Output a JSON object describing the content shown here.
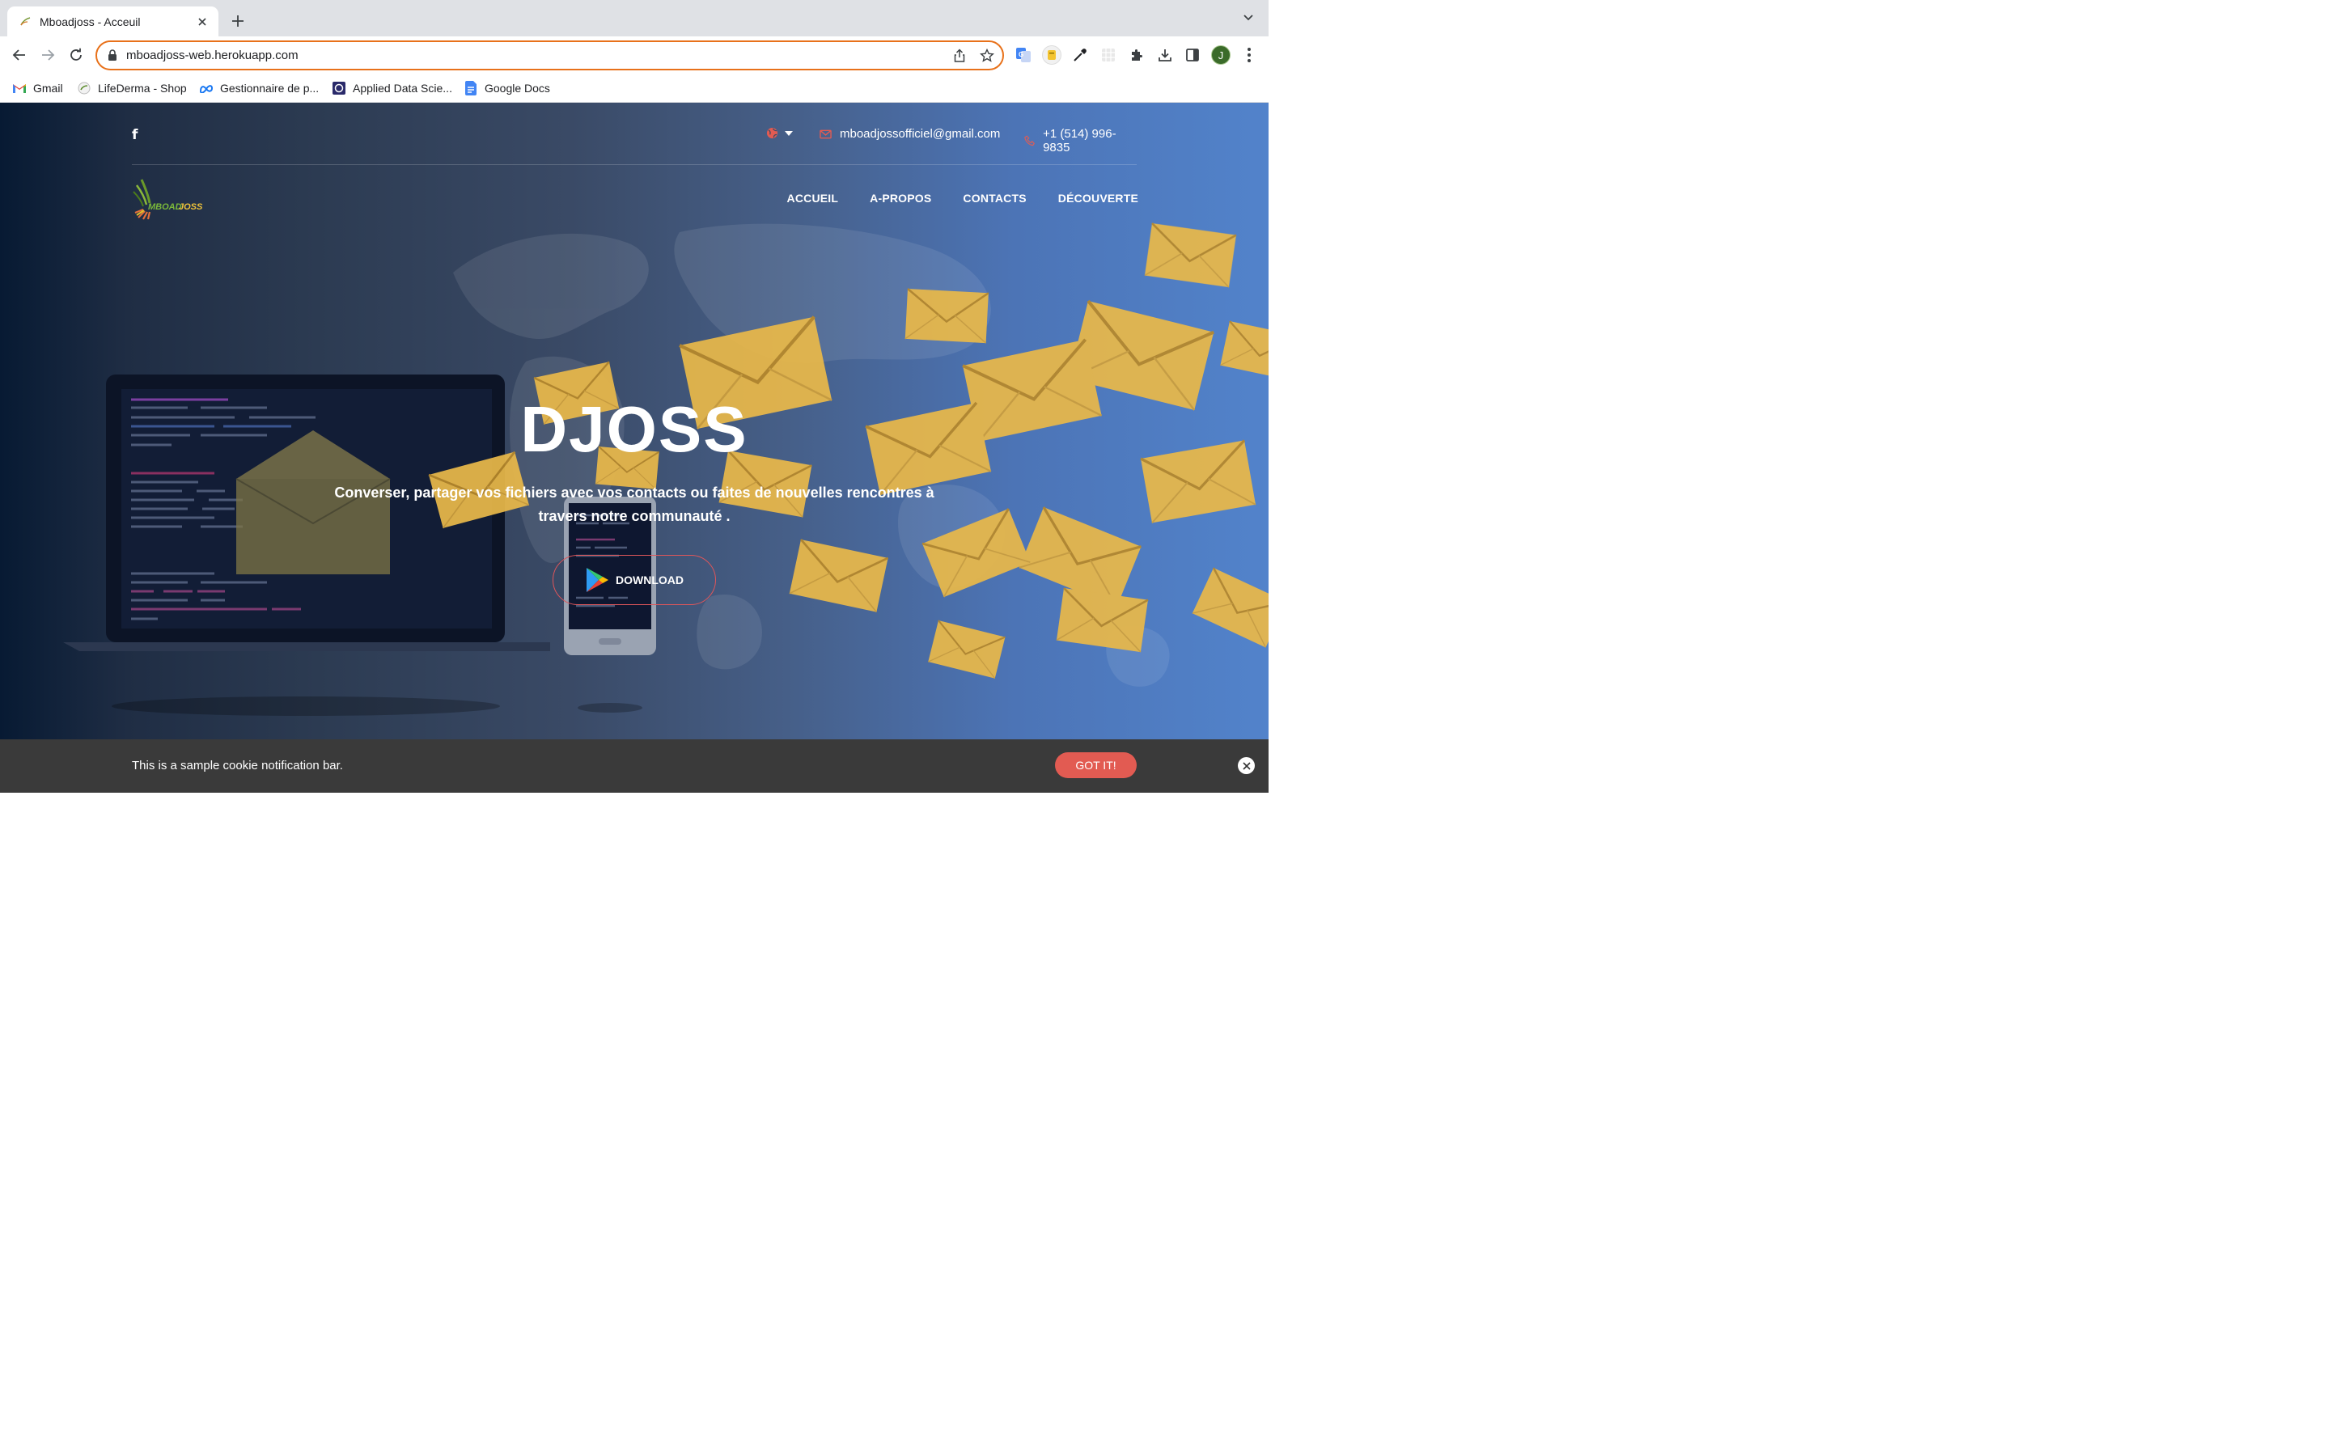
{
  "browser": {
    "tab_title": "Mboadjoss - Acceuil",
    "url": "mboadjoss-web.herokuapp.com",
    "profile_initial": "J",
    "bookmarks": [
      {
        "label": "Gmail",
        "icon": "gmail-icon"
      },
      {
        "label": "LifeDerma - Shop",
        "icon": "lifederma-icon"
      },
      {
        "label": "Gestionnaire de p...",
        "icon": "meta-icon"
      },
      {
        "label": "Applied Data Scie...",
        "icon": "coursera-icon"
      },
      {
        "label": "Google Docs",
        "icon": "google-docs-icon"
      }
    ]
  },
  "site": {
    "email": "mboadjossofficiel@gmail.com",
    "phone": "+1 (514) 996-9835",
    "nav": [
      "ACCUEIL",
      "A-PROPOS",
      "CONTACTS",
      "DÉCOUVERTE"
    ],
    "hero_title": "DJOSS",
    "hero_subtitle": "Converser, partager vos fichiers avec vos contacts ou faites de nouvelles rencontres à travers notre communauté .",
    "download_label": "DOWNLOAD"
  },
  "cookie": {
    "message": "This is a sample cookie notification bar.",
    "button": "GOT IT!"
  },
  "colors": {
    "accent": "#e25b52",
    "omnibox_border": "#e8711a",
    "envelope": "#e9b84a"
  }
}
